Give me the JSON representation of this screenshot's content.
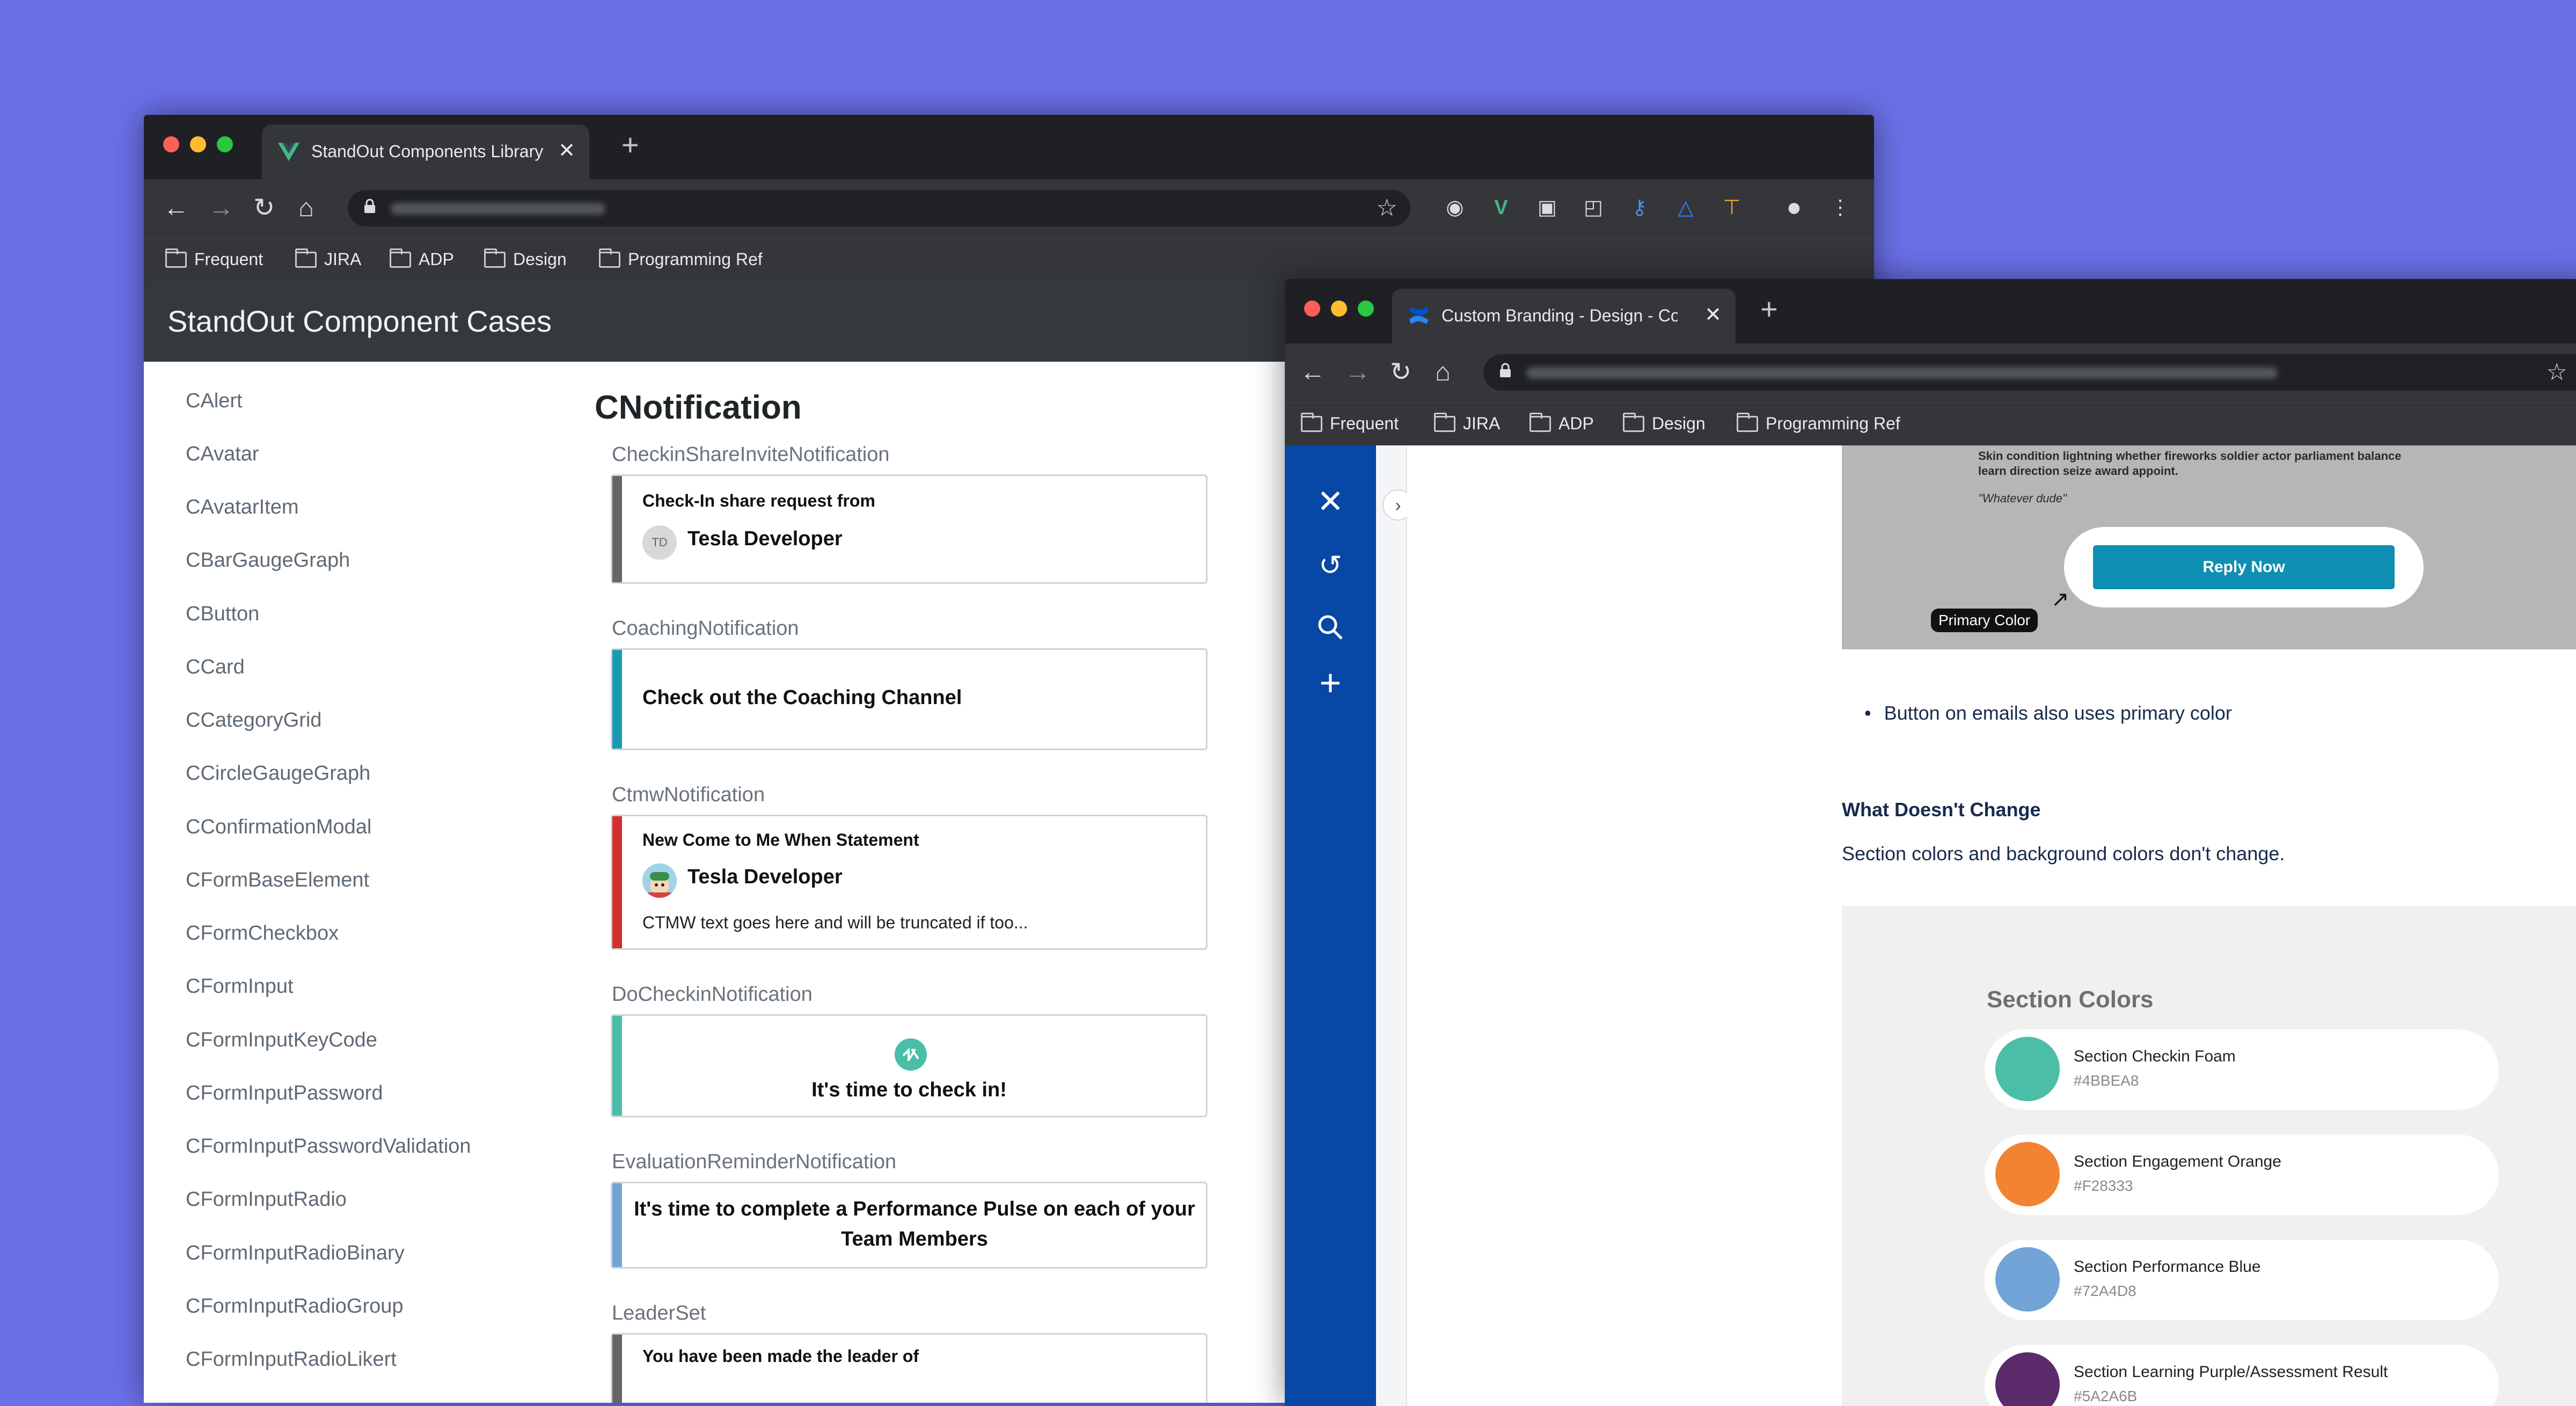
{
  "colors": {
    "desktop": "#6b70e8",
    "vue_green": "#41b883",
    "confluence_blue": "#0747a6",
    "coaching_bar": "#1a9bb2",
    "ctmw_bar": "#d32f2f",
    "checkin_bar": "#4bbea8",
    "evaluation_bar": "#72a4d8",
    "share_bar": "#666666"
  },
  "window1": {
    "tab_title": "StandOut Components Library",
    "bookmarks": [
      "Frequent",
      "JIRA",
      "ADP",
      "Design",
      "Programming Ref"
    ],
    "app_title": "StandOut Component Cases",
    "sidebar_items": [
      "CAlert",
      "CAvatar",
      "CAvatarItem",
      "CBarGaugeGraph",
      "CButton",
      "CCard",
      "CCategoryGrid",
      "CCircleGaugeGraph",
      "CConfirmationModal",
      "CFormBaseElement",
      "CFormCheckbox",
      "CFormInput",
      "CFormInputKeyCode",
      "CFormInputPassword",
      "CFormInputPasswordValidation",
      "CFormInputRadio",
      "CFormInputRadioBinary",
      "CFormInputRadioGroup",
      "CFormInputRadioLikert"
    ],
    "page_title": "CNotification",
    "sections": {
      "checkin_share": {
        "label": "CheckinShareInviteNotification",
        "subtitle": "Check-In share request from",
        "initials": "TD",
        "name": "Tesla Developer"
      },
      "coaching": {
        "label": "CoachingNotification",
        "text": "Check out the Coaching Channel"
      },
      "ctmw": {
        "label": "CtmwNotification",
        "subtitle": "New Come to Me When Statement",
        "name": "Tesla Developer",
        "body": "CTMW text goes here and will be truncated if too..."
      },
      "do_checkin": {
        "label": "DoCheckinNotification",
        "text": "It's time to check in!"
      },
      "evaluation": {
        "label": "EvaluationReminderNotification",
        "text": "It's time to complete a Performance Pulse on each of your Team Members"
      },
      "leaderset": {
        "label": "LeaderSet",
        "text": "You have been made the leader of"
      }
    }
  },
  "window2": {
    "tab_title": "Custom Branding - Design - Co",
    "bookmarks": [
      "Frequent",
      "JIRA",
      "ADP",
      "Design",
      "Programming Ref"
    ],
    "email_preview": {
      "line1": "Skin condition lightning whether fireworks soldier actor parliament balance",
      "line2": "learn direction seize award appoint.",
      "quote": "\"Whatever dude\"",
      "button": "Reply Now",
      "callout": "Primary Color"
    },
    "bullet": "Button on emails also uses primary color",
    "heading": "What Doesn't Change",
    "paragraph": "Section colors and background colors don't change.",
    "section_colors": {
      "title": "Section Colors",
      "items": [
        {
          "name": "Section Checkin Foam",
          "hex": "#4BBEA8"
        },
        {
          "name": "Section Engagement Orange",
          "hex": "#F28333"
        },
        {
          "name": "Section Performance Blue",
          "hex": "#72A4D8"
        },
        {
          "name": "Section Learning Purple/Assessment Result",
          "hex": "#5A2A6B"
        }
      ]
    }
  }
}
